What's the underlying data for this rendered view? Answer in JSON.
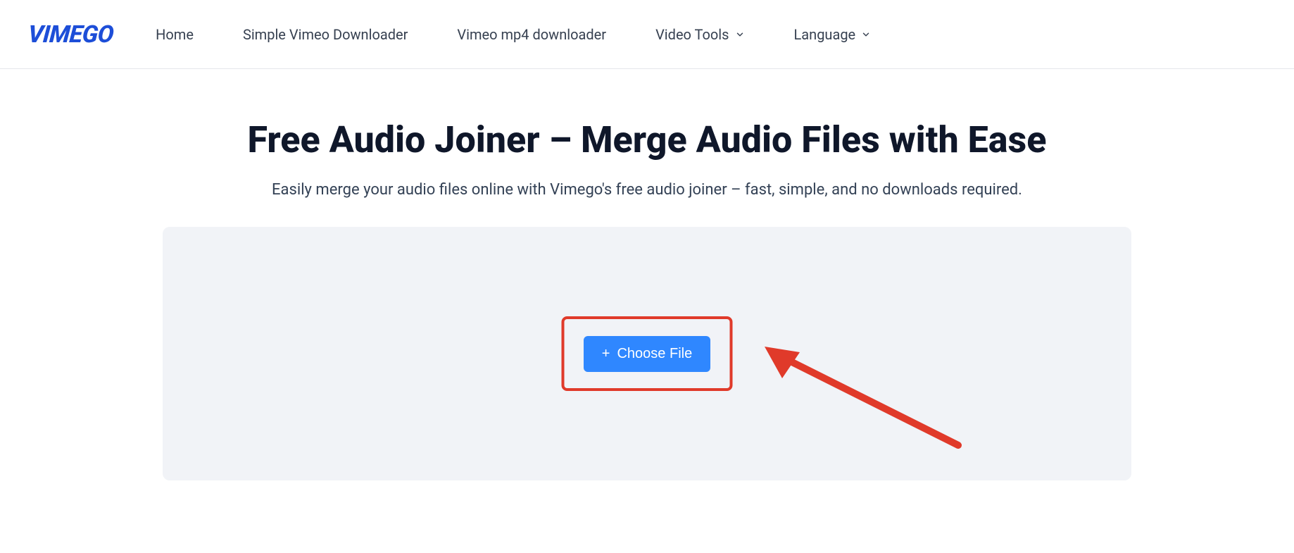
{
  "header": {
    "logo": "VIMEGO",
    "nav": {
      "home": "Home",
      "simple_downloader": "Simple Vimeo Downloader",
      "mp4_downloader": "Vimeo mp4 downloader",
      "video_tools": "Video Tools",
      "language": "Language"
    }
  },
  "main": {
    "title": "Free Audio Joiner – Merge Audio Files with Ease",
    "subtitle": "Easily merge your audio files online with Vimego's free audio joiner – fast, simple, and no downloads required.",
    "choose_file_label": "Choose File"
  },
  "colors": {
    "brand": "#1d4ed8",
    "button": "#2f87ff",
    "highlight": "#e03a2a",
    "panel_bg": "#f1f3f7"
  }
}
